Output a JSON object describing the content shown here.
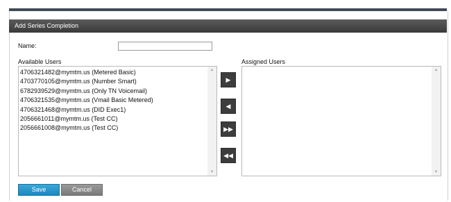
{
  "dialog": {
    "title": "Add Series Completion",
    "name_label": "Name:",
    "name_value": "",
    "available_label": "Available Users",
    "assigned_label": "Assigned Users",
    "available_users": [
      "4706321482@mymtm.us (Metered Basic)",
      "4703770105@mymtm.us (Number Smart)",
      "6782939529@mymtm.us (Only TN Voicemail)",
      "4706321535@mymtm.us (Vmail Basic Metered)",
      "4706321468@mymtm.us (DID Exec1)",
      "2056661011@mymtm.us (Test CC)",
      "2056661008@mymtm.us (Test CC)"
    ],
    "assigned_users": [],
    "buttons": {
      "add_one": "▶",
      "remove_one": "◀",
      "add_all": "▶▶",
      "remove_all": "◀◀",
      "save": "Save",
      "cancel": "Cancel"
    }
  }
}
